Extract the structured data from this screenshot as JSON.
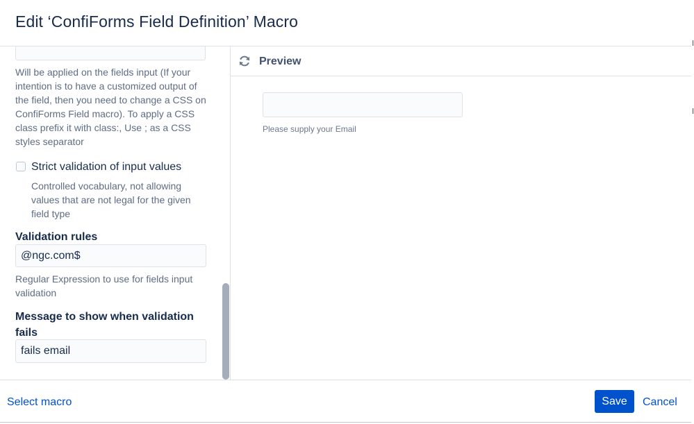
{
  "dialog": {
    "title": "Edit ‘ConfiForms Field Definition’ Macro"
  },
  "left_panel": {
    "css_help": "Will be applied on the fields input (If your intention is to have a customized output of the field, then you need to change a CSS on ConfiForms Field macro). To apply a CSS class prefix it with class:, Use ; as a CSS styles separator",
    "strict_validation": {
      "label": "Strict validation of input values",
      "checked": false,
      "help": "Controlled vocabulary, not allowing values that are not legal for the given field type"
    },
    "validation_rules": {
      "label": "Validation rules",
      "value": "@ngc.com$",
      "help": "Regular Expression to use for fields input validation"
    },
    "validation_message": {
      "label": "Message to show when validation fails",
      "value": "fails email"
    }
  },
  "preview": {
    "title": "Preview",
    "icon": "refresh-icon",
    "field_help": "Please supply your Email"
  },
  "footer": {
    "select_macro": "Select macro",
    "save_label": "Save",
    "cancel_label": "Cancel"
  },
  "colors": {
    "accent": "#0052cc",
    "text": "#172b4d",
    "muted": "#5e6c84",
    "border": "#dfe1e6"
  }
}
